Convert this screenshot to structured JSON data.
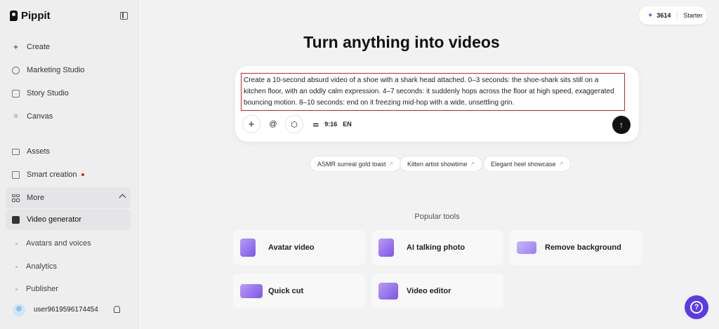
{
  "app": {
    "name": "Pippit"
  },
  "sidebar": {
    "items": [
      {
        "label": "Create",
        "icon": "sparkle-icon"
      },
      {
        "label": "Marketing Studio",
        "icon": "clock-icon"
      },
      {
        "label": "Story Studio",
        "icon": "play-box-icon"
      },
      {
        "label": "Canvas",
        "icon": "crop-icon"
      },
      {
        "label": "Assets",
        "icon": "folder-icon"
      },
      {
        "label": "Smart creation",
        "icon": "refresh-box-icon"
      },
      {
        "label": "More",
        "icon": "grid-icon"
      },
      {
        "label": "Video generator",
        "icon": "video-gen-icon"
      }
    ],
    "sub_items": [
      {
        "label": "Avatars and voices"
      },
      {
        "label": "Analytics"
      },
      {
        "label": "Publisher"
      }
    ],
    "user": {
      "name": "user9619596174454"
    }
  },
  "credits": {
    "amount": "3614",
    "plan": "Starter"
  },
  "main": {
    "headline": "Turn anything into videos",
    "prompt": "Create a 10-second absurd video of a shoe with a shark head attached. 0–3 seconds: the shoe-shark sits still on a kitchen floor, with an oddly calm expression. 4–7 seconds: it suddenly hops across the floor at high speed, exaggerated bouncing motion. 8–10 seconds: end on it freezing mid-hop with a wide, unsettling grin.",
    "toolbar": {
      "ratio": "9:16",
      "lang": "EN",
      "add": "+",
      "mention": "@"
    },
    "suggestions": [
      {
        "label": "ASMR surreal gold toast"
      },
      {
        "label": "Kitten artist showtime"
      },
      {
        "label": "Elegant heel showcase"
      }
    ],
    "popular_title": "Popular tools",
    "tools": [
      {
        "label": "Avatar video"
      },
      {
        "label": "AI talking photo"
      },
      {
        "label": "Remove background"
      },
      {
        "label": "Quick cut"
      },
      {
        "label": "Video editor"
      }
    ]
  },
  "colors": {
    "accent": "#5a3be6",
    "highlight_border": "#c6252c"
  }
}
